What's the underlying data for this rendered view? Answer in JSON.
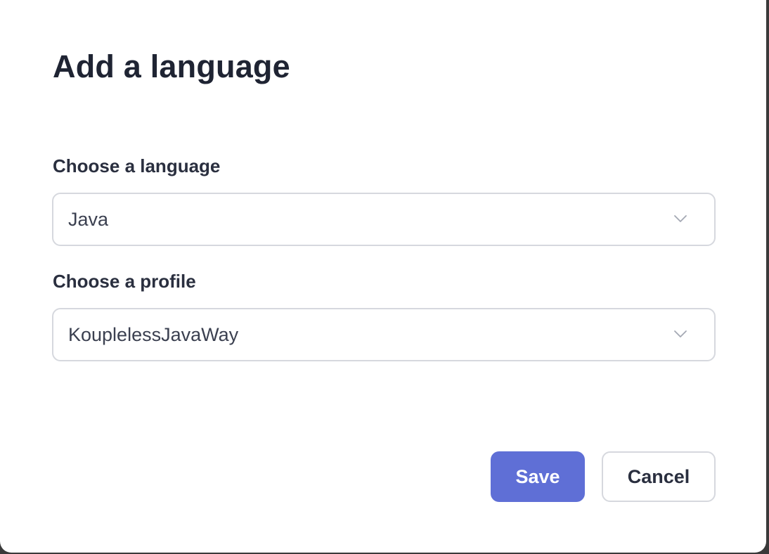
{
  "dialog": {
    "title": "Add a language"
  },
  "language_field": {
    "label": "Choose a language",
    "value": "Java",
    "icon": "chevron-down-icon"
  },
  "profile_field": {
    "label": "Choose a profile",
    "value": "KouplelessJavaWay",
    "icon": "chevron-down-icon"
  },
  "actions": {
    "save_label": "Save",
    "cancel_label": "Cancel"
  },
  "colors": {
    "primary": "#5f6fd6",
    "text_dark": "#1f2433",
    "border": "#d6d8de",
    "backdrop": "#3a3a3a"
  }
}
